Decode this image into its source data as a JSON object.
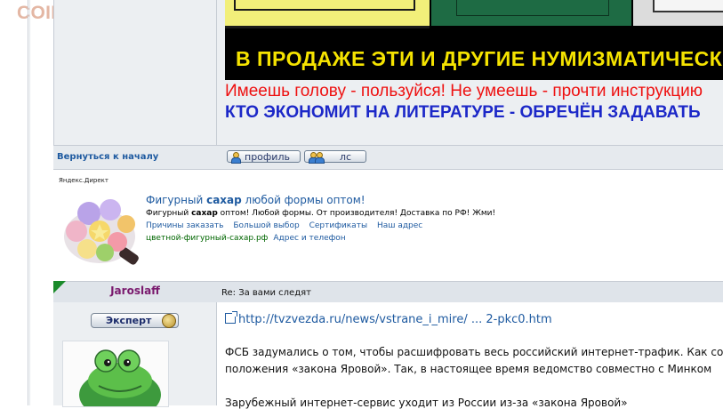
{
  "watermark": "COINS.LAVE.RU",
  "post1": {
    "banner_text": "В ПРОДАЖЕ ЭТИ И ДРУГИЕ НУМИЗМАТИЧЕСКИЕ",
    "red_line": "Имеешь голову - пользуйся! Не умеешь - прочти инструкцию",
    "blue_line": "КТО ЭКОНОМИТ НА ЛИТЕРАТУРЕ - ОБРЕЧЁН ЗАДАВАТЬ"
  },
  "profile_row": {
    "back_link": "Вернуться к началу",
    "profile_button": "профиль",
    "pm_button": "лс"
  },
  "ad": {
    "label": "Яндекс.Директ",
    "title_pre": "Фигурный ",
    "title_bold": "сахар",
    "title_post": " любой формы оптом!",
    "desc_pre": "Фигурный ",
    "desc_bold": "сахар",
    "desc_post": " оптом! Любой формы. От производителя! Доставка по РФ! Жми!",
    "links": [
      "Причины заказать",
      "Большой выбор",
      "Сертификаты",
      "Наш адрес"
    ],
    "domain": "цветной-фигурный-сахар.рф",
    "address": "Адрес и телефон"
  },
  "post2": {
    "author": "Jaroslaff",
    "title": "Re: За вами следят",
    "rank": "Эксперт",
    "url": "http://tvzvezda.ru/news/vstrane_i_mire/ ... 2-pkc0.htm",
    "para1": "ФСБ задумались о том, чтобы расшифровать весь российский интернет-трафик. Как со",
    "para2": "положения «закона Яровой». Так, в настоящее время ведомство совместно с Минком",
    "para3": "Зарубежный интернет-сервис уходит из России из-за «закона Яровой»"
  },
  "colors": {
    "link": "#1e5aa0",
    "red_text": "#ee1111",
    "blue_text": "#1c28c8",
    "banner_yellow": "#f5e300",
    "author": "#7a1a6e",
    "corner": "#1a8a2a"
  }
}
